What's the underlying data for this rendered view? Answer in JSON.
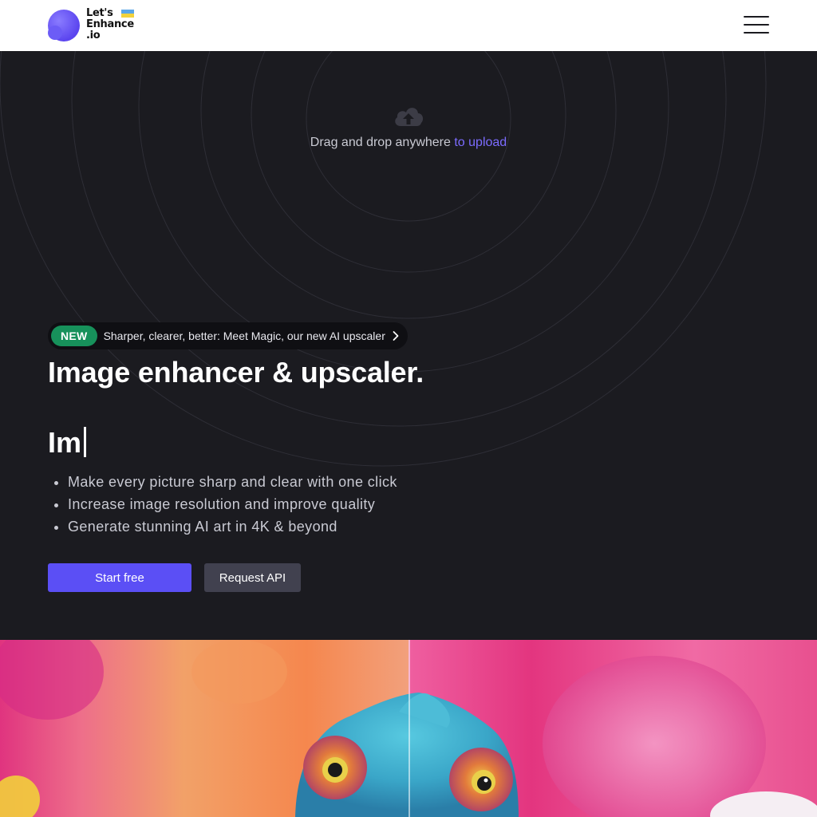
{
  "header": {
    "logo": {
      "line1": "Let's",
      "line2": "Enhance",
      "line3": ".io"
    },
    "menu_icon": "hamburger-menu-icon"
  },
  "upload": {
    "icon": "cloud-upload-icon",
    "text": "Drag and drop anywhere",
    "link": "to upload"
  },
  "announcement": {
    "badge": "NEW",
    "text": "Sharper, clearer, better: Meet Magic, our new AI upscaler",
    "icon": "chevron-right-icon"
  },
  "hero": {
    "headline": "Image enhancer & upscaler.",
    "typed": "Im",
    "features": [
      "Make every picture sharp and clear with one click",
      "Increase image resolution and improve quality",
      "Generate stunning AI art in 4K & beyond"
    ]
  },
  "buttons": {
    "start": "Start free",
    "api": "Request API"
  },
  "colors": {
    "accent": "#5b4ff5",
    "link": "#7c6cff",
    "badge_green": "#17915b",
    "background": "#1b1b20"
  }
}
